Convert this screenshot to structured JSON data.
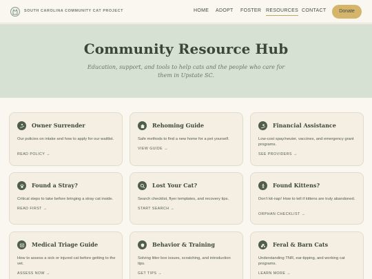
{
  "header": {
    "brand": "SOUTH CAROLINA COMMUNITY CAT PROJECT",
    "nav": [
      "HOME",
      "ADOPT",
      "FOSTER",
      "RESOURCES",
      "CONTACT"
    ],
    "active_nav": "RESOURCES",
    "donate_label": "Donate",
    "logo_icon": "cat-icon"
  },
  "hero": {
    "title": "Community Resource Hub",
    "subtitle": "Education, support, and tools to help cats and the people who care for them in Upstate SC."
  },
  "colors": {
    "hero_bg": "#d6e1d4",
    "accent": "#d5b46c",
    "card_bg": "#f5efe3",
    "icon_bg": "#4e5d4c"
  },
  "cards": [
    {
      "title": "Owner Surrender",
      "desc": "Our policies on intake and how to apply for our waitlist.",
      "link": "READ POLICY →",
      "icon": "hand-heart-icon"
    },
    {
      "title": "Rehoming Guide",
      "desc": "Safe methods to find a new home for a pet yourself.",
      "link": "VIEW GUIDE →",
      "icon": "home-icon"
    },
    {
      "title": "Financial Assistance",
      "desc": "Low-cost spay/neuter, vaccines, and emergency grant programs.",
      "link": "SEE PROVIDERS →",
      "icon": "hand-coin-icon"
    },
    {
      "title": "Found a Stray?",
      "desc": "Critical steps to take before bringing a stray cat inside.",
      "link": "READ FIRST →",
      "icon": "paw-icon"
    },
    {
      "title": "Lost Your Cat?",
      "desc": "Search checklist, flyer templates, and recovery tips.",
      "link": "START SEARCH →",
      "icon": "search-icon"
    },
    {
      "title": "Found Kittens?",
      "desc": "Don't kit-nap! How to tell if kittens are truly abandoned.",
      "link": "ORPHAN CHECKLIST →",
      "icon": "baby-icon"
    },
    {
      "title": "Medical Triage Guide",
      "desc": "How to assess a sick or injured cat before getting to the vet.",
      "link": "ASSESS NOW →",
      "icon": "medical-icon"
    },
    {
      "title": "Behavior & Training",
      "desc": "Solving litter box issues, scratching, and introduction tips.",
      "link": "GET TIPS →",
      "icon": "brain-icon"
    },
    {
      "title": "Feral & Barn Cats",
      "desc": "Understanding TNR, ear-tipping, and working cat programs.",
      "link": "LEARN MORE →",
      "icon": "tractor-icon"
    }
  ]
}
